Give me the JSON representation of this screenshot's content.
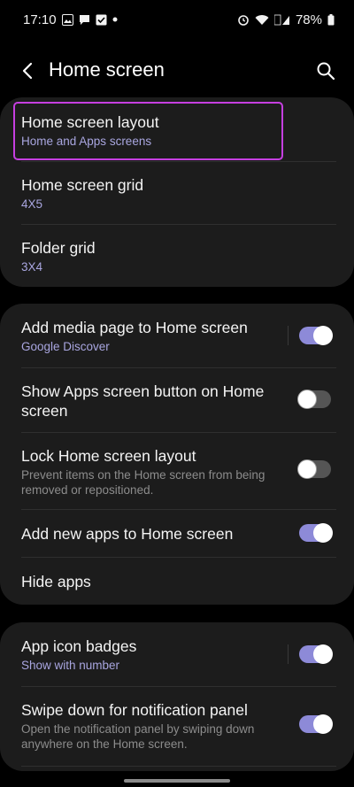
{
  "status": {
    "time": "17:10",
    "battery": "78%"
  },
  "header": {
    "title": "Home screen"
  },
  "group1": {
    "home_layout": {
      "title": "Home screen layout",
      "sub": "Home and Apps screens"
    },
    "home_grid": {
      "title": "Home screen grid",
      "sub": "4X5"
    },
    "folder_grid": {
      "title": "Folder grid",
      "sub": "3X4"
    }
  },
  "group2": {
    "media_page": {
      "title": "Add media page to Home screen",
      "sub": "Google Discover",
      "enabled": true
    },
    "apps_button": {
      "title_line1": "Show Apps screen button on Home",
      "title_line2": "screen",
      "enabled": false
    },
    "lock_layout": {
      "title": "Lock Home screen layout",
      "desc_line1": "Prevent items on the Home screen from being",
      "desc_line2": "removed or repositioned.",
      "enabled": false
    },
    "add_new_apps": {
      "title": "Add new apps to Home screen",
      "enabled": true
    },
    "hide_apps": {
      "title": "Hide apps"
    }
  },
  "group3": {
    "badges": {
      "title": "App icon badges",
      "sub": "Show with number",
      "enabled": true
    },
    "swipe_down": {
      "title": "Swipe down for notification panel",
      "desc_line1": "Open the notification panel by swiping down",
      "desc_line2": "anywhere on the Home screen.",
      "enabled": true
    }
  },
  "colors": {
    "accent": "#8d8ad8",
    "highlight": "#c53fe0",
    "card": "#1c1c1c",
    "subtext": "#a9a6e0"
  }
}
